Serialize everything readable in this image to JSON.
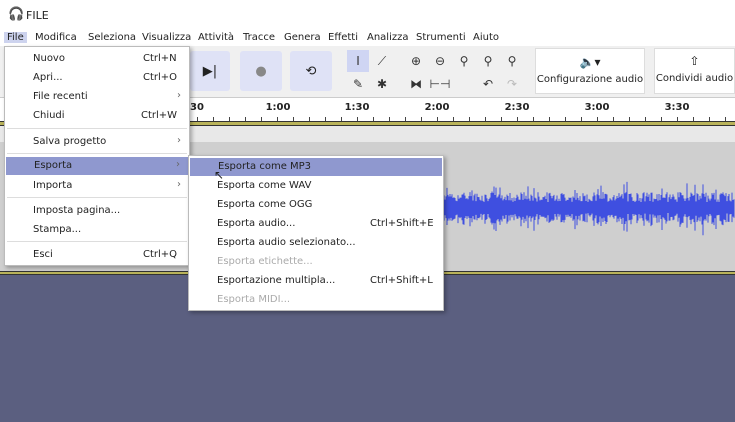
{
  "window": {
    "title": "FILE",
    "accent": "#8f98cf",
    "waveform_color": "#3f4fe0"
  },
  "menubar": [
    "File",
    "Modifica",
    "Seleziona",
    "Visualizza",
    "Attività",
    "Tracce",
    "Genera",
    "Effetti",
    "Analizza",
    "Strumenti",
    "Aiuto"
  ],
  "toolbar": {
    "config_audio": "Configurazione audio",
    "share_audio": "Condividi audio"
  },
  "ruler": [
    "30",
    "1:00",
    "1:30",
    "2:00",
    "2:30",
    "3:00",
    "3:30"
  ],
  "file_menu": [
    {
      "label": "Nuovo",
      "shortcut": "Ctrl+N"
    },
    {
      "label": "Apri...",
      "shortcut": "Ctrl+O"
    },
    {
      "label": "File recenti",
      "submenu": true
    },
    {
      "label": "Chiudi",
      "shortcut": "Ctrl+W"
    },
    {
      "label": "Salva progetto",
      "submenu": true
    },
    {
      "label": "Esporta",
      "submenu": true,
      "selected": true
    },
    {
      "label": "Importa",
      "submenu": true
    },
    {
      "label": "Imposta pagina..."
    },
    {
      "label": "Stampa..."
    },
    {
      "label": "Esci",
      "shortcut": "Ctrl+Q"
    }
  ],
  "export_menu": [
    {
      "label": "Esporta come MP3",
      "selected": true
    },
    {
      "label": "Esporta come WAV"
    },
    {
      "label": "Esporta come OGG"
    },
    {
      "label": "Esporta audio...",
      "shortcut": "Ctrl+Shift+E"
    },
    {
      "label": "Esporta audio selezionato..."
    },
    {
      "label": "Esporta etichette...",
      "disabled": true
    },
    {
      "label": "Esportazione multipla...",
      "shortcut": "Ctrl+Shift+L"
    },
    {
      "label": "Esporta MIDI...",
      "disabled": true
    }
  ]
}
